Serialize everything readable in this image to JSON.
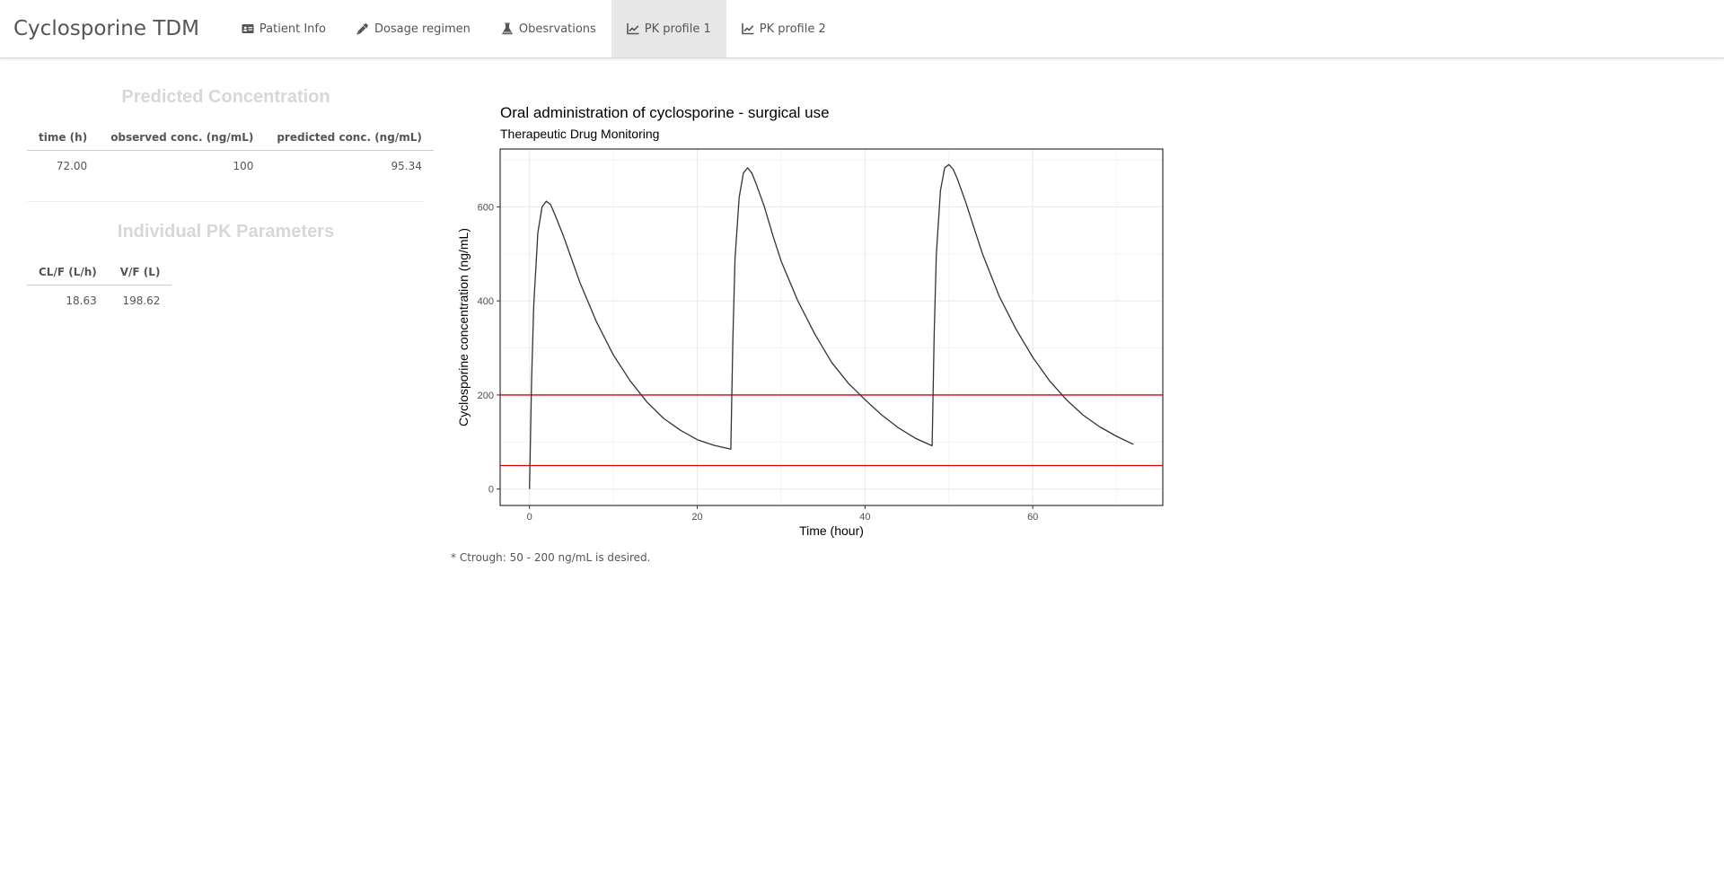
{
  "app": {
    "title": "Cyclosporine TDM"
  },
  "nav": {
    "tabs": [
      {
        "label": "Patient Info",
        "icon": "id-card-icon",
        "active": false
      },
      {
        "label": "Dosage regimen",
        "icon": "eyedropper-icon",
        "active": false
      },
      {
        "label": "Obesrvations",
        "icon": "flask-icon",
        "active": false
      },
      {
        "label": "PK profile 1",
        "icon": "line-chart-icon",
        "active": true
      },
      {
        "label": "PK profile 2",
        "icon": "line-chart-icon",
        "active": false
      }
    ]
  },
  "predicted": {
    "title": "Predicted Concentration",
    "columns": [
      "time (h)",
      "observed conc. (ng/mL)",
      "predicted conc. (ng/mL)"
    ],
    "rows": [
      [
        "72.00",
        "100",
        "95.34"
      ]
    ]
  },
  "pk_params": {
    "title": "Individual PK Parameters",
    "columns": [
      "CL/F (L/h)",
      "V/F (L)"
    ],
    "rows": [
      [
        "18.63",
        "198.62"
      ]
    ]
  },
  "chart_data": {
    "type": "line",
    "title": "Oral administration of cyclosporine - surgical use",
    "subtitle": "Therapeutic Drug Monitoring",
    "xlabel": "Time (hour)",
    "ylabel": "Cyclosporine concentration (ng/mL)",
    "xlim": [
      -3.5,
      75.5
    ],
    "ylim": [
      -35,
      723
    ],
    "xticks": [
      0,
      20,
      40,
      60
    ],
    "yticks": [
      0,
      200,
      400,
      600
    ],
    "grid": true,
    "series": [
      {
        "color": "#333333",
        "x": [
          0,
          0.25,
          0.5,
          1,
          1.5,
          2,
          2.5,
          3,
          4,
          5,
          6,
          8,
          10,
          12,
          14,
          16,
          18,
          20,
          22,
          24,
          24.25,
          24.5,
          25,
          25.5,
          26,
          26.5,
          27,
          28,
          29,
          30,
          32,
          34,
          36,
          38,
          40,
          42,
          44,
          46,
          48,
          48.25,
          48.5,
          49,
          49.5,
          50,
          50.5,
          51,
          52,
          53,
          54,
          56,
          58,
          60,
          62,
          64,
          66,
          68,
          70,
          72
        ],
        "y": [
          0,
          230,
          390,
          545,
          600,
          612,
          605,
          585,
          540,
          490,
          440,
          355,
          285,
          230,
          185,
          150,
          125,
          105,
          93,
          85,
          320,
          490,
          620,
          672,
          683,
          672,
          650,
          600,
          540,
          485,
          400,
          330,
          270,
          225,
          190,
          157,
          130,
          108,
          92,
          330,
          500,
          635,
          683,
          690,
          680,
          660,
          610,
          555,
          500,
          410,
          340,
          280,
          230,
          190,
          157,
          132,
          112,
          95
        ]
      }
    ],
    "hlines": [
      {
        "y": 200,
        "color": "#e00000"
      },
      {
        "y": 50,
        "color": "#e00000"
      }
    ]
  },
  "note": "* Ctrough: 50 - 200 ng/mL is desired."
}
